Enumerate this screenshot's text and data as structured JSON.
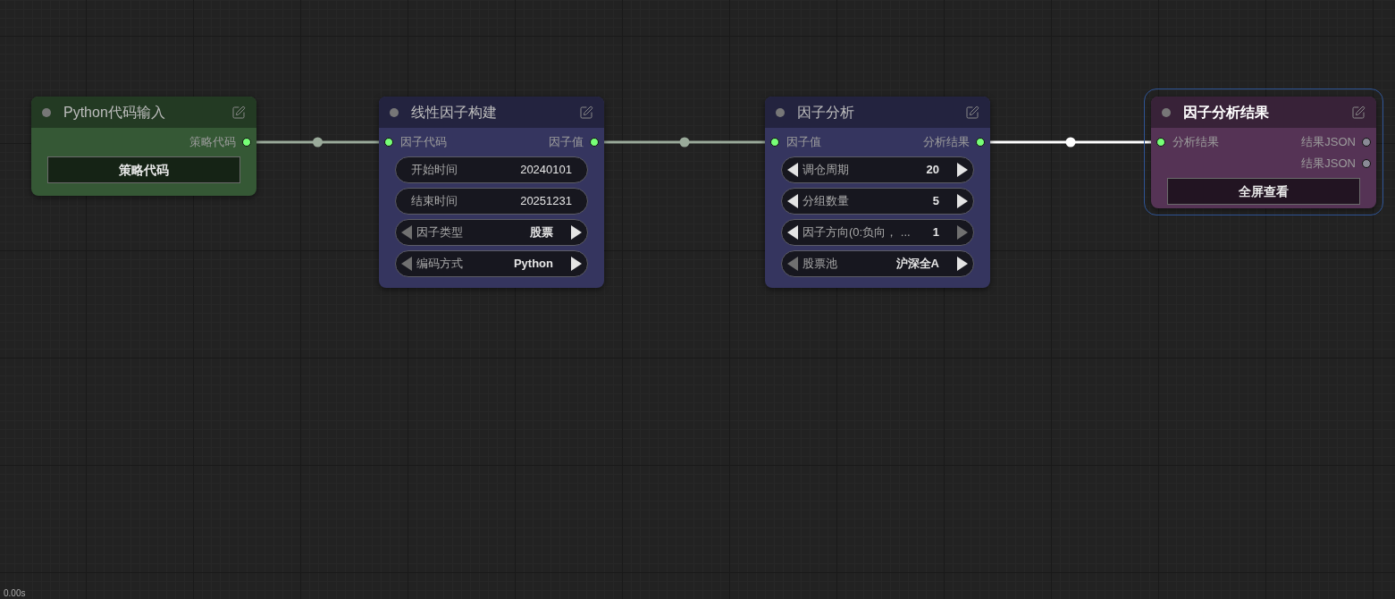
{
  "nodes": [
    {
      "title": "Python代码输入",
      "selected": false,
      "color": "#355835",
      "outputs": [
        {
          "label": "策略代码",
          "connected": true
        }
      ],
      "widgets": [
        {
          "kind": "button",
          "label": "策略代码"
        }
      ]
    },
    {
      "title": "线性因子构建",
      "selected": false,
      "color": "#35355f",
      "inputs": [
        {
          "label": "因子代码",
          "connected": true
        }
      ],
      "outputs": [
        {
          "label": "因子值",
          "connected": true
        }
      ],
      "widgets": [
        {
          "kind": "text",
          "label": "开始时间",
          "value": "20240101"
        },
        {
          "kind": "text",
          "label": "结束时间",
          "value": "20251231"
        },
        {
          "kind": "stepper",
          "label": "因子类型",
          "value": "股票",
          "prev_enabled": false,
          "next_enabled": true
        },
        {
          "kind": "stepper",
          "label": "编码方式",
          "value": "Python",
          "prev_enabled": false,
          "next_enabled": true
        }
      ]
    },
    {
      "title": "因子分析",
      "selected": false,
      "color": "#35355f",
      "inputs": [
        {
          "label": "因子值",
          "connected": true
        }
      ],
      "outputs": [
        {
          "label": "分析结果",
          "connected": true
        }
      ],
      "widgets": [
        {
          "kind": "stepper",
          "label": "调仓周期",
          "value": "20",
          "prev_enabled": true,
          "next_enabled": true
        },
        {
          "kind": "stepper",
          "label": "分组数量",
          "value": "5",
          "prev_enabled": true,
          "next_enabled": true
        },
        {
          "kind": "stepper",
          "label": "因子方向(0:负向， ...",
          "value": "1",
          "prev_enabled": true,
          "next_enabled": false
        },
        {
          "kind": "stepper",
          "label": "股票池",
          "value": "沪深全A",
          "prev_enabled": false,
          "next_enabled": true
        }
      ]
    },
    {
      "title": "因子分析结果",
      "selected": true,
      "color": "#553355",
      "inputs": [
        {
          "label": "分析结果",
          "connected": true
        }
      ],
      "outputs": [
        {
          "label": "结果JSON",
          "connected": false
        },
        {
          "label": "结果JSON",
          "connected": false
        }
      ],
      "widgets": [
        {
          "kind": "button",
          "label": "全屏查看"
        }
      ]
    }
  ],
  "links": [
    {
      "highlighted": false
    },
    {
      "highlighted": false
    },
    {
      "highlighted": true
    }
  ],
  "status": "0.00s"
}
